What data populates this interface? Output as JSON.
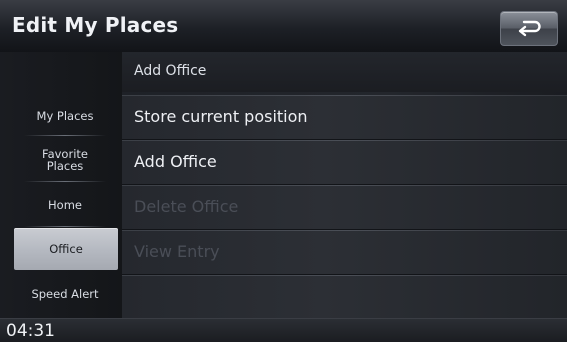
{
  "title": "Edit My Places",
  "back_button": {
    "icon": "return-arrow-icon"
  },
  "sidebar": {
    "items": [
      {
        "label": "My Places"
      },
      {
        "label": "Favorite Places"
      },
      {
        "label": "Home"
      },
      {
        "label": "Office",
        "active": true
      },
      {
        "label": "Speed Alert"
      }
    ]
  },
  "content": {
    "header": "Add Office",
    "items": [
      {
        "label": "Store current position",
        "enabled": true
      },
      {
        "label": "Add Office",
        "enabled": true
      },
      {
        "label": "Delete Office",
        "enabled": false
      },
      {
        "label": "View Entry",
        "enabled": false
      },
      {
        "label": "",
        "enabled": false
      }
    ]
  },
  "status": {
    "time": "04:31"
  },
  "colors": {
    "active_tab": "#b9bdc5",
    "title_text": "#f0f2f6",
    "disabled_text": "#4a4e57"
  }
}
